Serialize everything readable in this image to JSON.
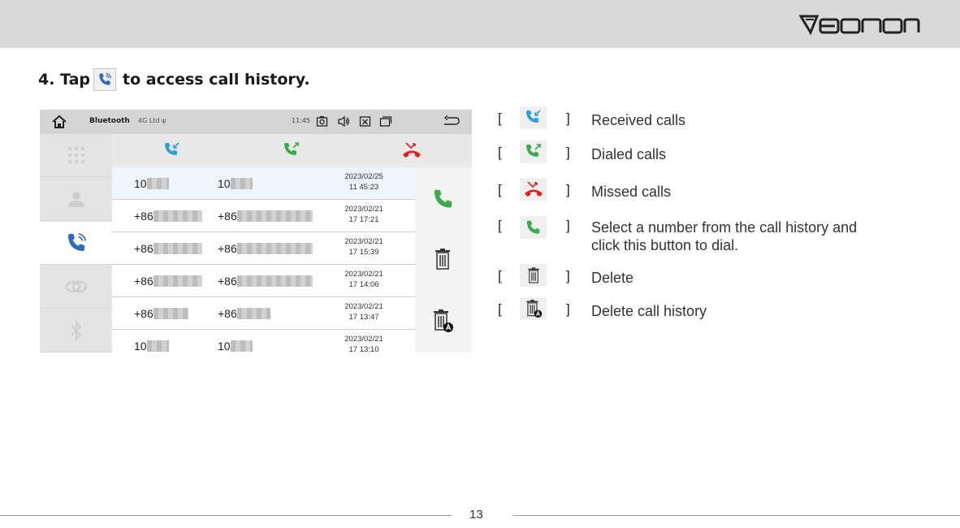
{
  "brand": {
    "logo_text": "EONON"
  },
  "instruction": {
    "prefix": "4. Tap",
    "suffix": "to access call history."
  },
  "device_screen": {
    "status_bar": {
      "title": "Bluetooth",
      "signal": "4G Ltd ψ",
      "time": "11:45"
    },
    "tabs": [
      "received-calls",
      "dialed-calls",
      "missed-calls"
    ],
    "rows": [
      {
        "n1": "10",
        "n2": "10",
        "date": "2023/02/25",
        "time": "11 45:23"
      },
      {
        "n1": "+86",
        "n2": "+86",
        "date": "2023/02/21",
        "time": "17 17:21"
      },
      {
        "n1": "+86",
        "n2": "+86",
        "date": "2023/02/21",
        "time": "17 15:39"
      },
      {
        "n1": "+86",
        "n2": "+86",
        "date": "2023/02/21",
        "time": "17 14:06"
      },
      {
        "n1": "+86",
        "n2": "+86",
        "date": "2023/02/21",
        "time": "17 13:47"
      },
      {
        "n1": "10",
        "n2": "10",
        "date": "2023/02/21",
        "time": "17 13:10"
      }
    ]
  },
  "legend": {
    "open_bracket": "[",
    "close_bracket": "]",
    "items": [
      {
        "icon": "received-call-icon",
        "label": "Received calls"
      },
      {
        "icon": "dialed-call-icon",
        "label": "Dialed calls"
      },
      {
        "icon": "missed-call-icon",
        "label": "Missed calls"
      },
      {
        "icon": "dial-icon",
        "label_line1": "Select a number from the call history and",
        "label_line2": "click this button to dial."
      },
      {
        "icon": "trash-icon",
        "label": "Delete"
      },
      {
        "icon": "delete-all-icon",
        "label": "Delete call history"
      }
    ]
  },
  "footer": {
    "page_number": "13"
  },
  "colors": {
    "received": "#2a9fd8",
    "dialed": "#3aaa4a",
    "missed": "#e02020",
    "call_log_blue": "#2b6cc4"
  }
}
